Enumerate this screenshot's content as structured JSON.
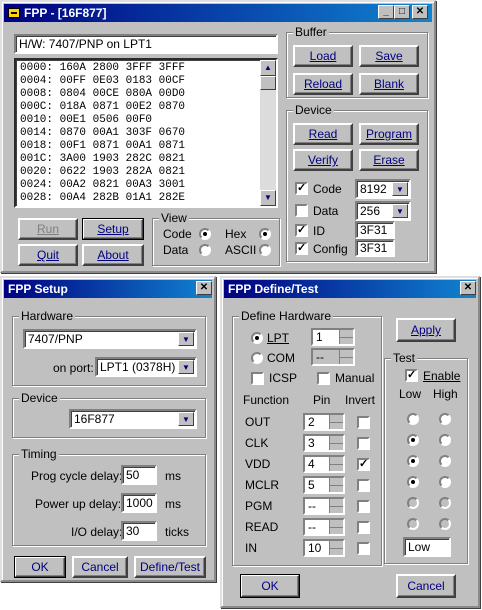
{
  "main": {
    "title": "FPP - [16F877]",
    "hw_status": "H/W: 7407/PNP on LPT1",
    "hex_lines": [
      "0000: 160A 2800 3FFF 3FFF",
      "0004: 00FF 0E03 0183 00CF",
      "0008: 0804 00CE 080A 00D0",
      "000C: 018A 0871 00E2 0870",
      "0010: 00E1 0506 00F0",
      "0014: 0870 00A1 303F 0670",
      "0018: 00F1 0871 00A1 0871",
      "001C: 3A00 1903 282C 0821",
      "0020: 0622 1903 282A 0821",
      "0024: 00A2 0821 00A3 3001",
      "0028: 00A4 282B 01A1 282E"
    ],
    "buttons": {
      "run": "Run",
      "setup": "Setup",
      "quit": "Quit",
      "about": "About"
    },
    "view": {
      "label": "View",
      "code": "Code",
      "data": "Data",
      "hex": "Hex",
      "ascii": "ASCII"
    },
    "buffer": {
      "label": "Buffer",
      "load": "Load",
      "save": "Save",
      "reload": "Reload",
      "blank": "Blank"
    },
    "device": {
      "label": "Device",
      "read": "Read",
      "program": "Program",
      "verify": "Verify",
      "erase": "Erase",
      "code_label": "Code",
      "code_value": "8192",
      "data_label": "Data",
      "data_value": "256",
      "id_label": "ID",
      "id_value": "3F31",
      "config_label": "Config",
      "config_value": "3F31"
    }
  },
  "setup": {
    "title": "FPP Setup",
    "hardware_label": "Hardware",
    "hardware_value": "7407/PNP",
    "port_label": "on port:",
    "port_value": "LPT1  (0378H)",
    "device_label": "Device",
    "device_value": "16F877",
    "timing_label": "Timing",
    "prog_delay_label": "Prog cycle delay:",
    "prog_delay_value": "50",
    "prog_delay_unit": "ms",
    "power_delay_label": "Power up delay:",
    "power_delay_value": "1000",
    "power_delay_unit": "ms",
    "io_delay_label": "I/O delay:",
    "io_delay_value": "30",
    "io_delay_unit": "ticks",
    "ok": "OK",
    "cancel": "Cancel",
    "define_test": "Define/Test"
  },
  "define": {
    "title": "FPP Define/Test",
    "hw_label": "Define Hardware",
    "lpt_label": "LPT",
    "lpt_value": "1",
    "com_label": "COM",
    "com_value": "--",
    "icsp_label": "ICSP",
    "manual_label": "Manual",
    "col_function": "Function",
    "col_pin": "Pin",
    "col_invert": "Invert",
    "rows": [
      {
        "fn": "OUT",
        "pin": "2",
        "invert": false
      },
      {
        "fn": "CLK",
        "pin": "3",
        "invert": false
      },
      {
        "fn": "VDD",
        "pin": "4",
        "invert": true
      },
      {
        "fn": "MCLR",
        "pin": "5",
        "invert": false
      },
      {
        "fn": "PGM",
        "pin": "--",
        "invert": false
      },
      {
        "fn": "READ",
        "pin": "--",
        "invert": false
      },
      {
        "fn": "IN",
        "pin": "10",
        "invert": false
      }
    ],
    "apply": "Apply",
    "test_label": "Test",
    "enable_label": "Enable",
    "low_label": "Low",
    "high_label": "High",
    "test_value": "Low",
    "ok": "OK",
    "cancel": "Cancel"
  }
}
